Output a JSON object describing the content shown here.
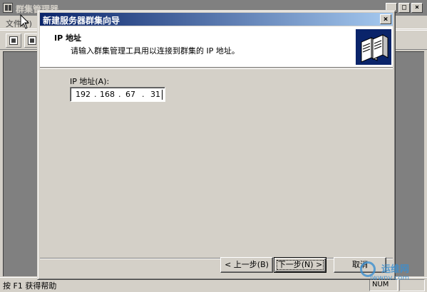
{
  "parent": {
    "title": "群集管理器",
    "menu_file": "文件(F)",
    "status_text": "按 F1 获得帮助",
    "status_panel": "NUM",
    "controls": {
      "minimize": "_",
      "maximize": "□",
      "close": "×"
    }
  },
  "wizard": {
    "title": "新建服务器群集向导",
    "close_glyph": "×",
    "header_title": "IP 地址",
    "header_subtitle": "请输入群集管理工具用以连接到群集的 IP 地址。",
    "ip_label": "IP 地址(A):",
    "ip_segments": [
      "192",
      "168",
      "67",
      "31"
    ],
    "ip_separator": ".",
    "buttons": {
      "back": "< 上一步(B)",
      "next": "下一步(N) >",
      "cancel": "取消"
    }
  },
  "watermark": {
    "cn": "运维网",
    "url": "iwwnv.com"
  },
  "colors": {
    "title_active_start": "#0a246a",
    "title_active_end": "#a6caf0",
    "title_inactive": "#808080",
    "face": "#d4d0c8",
    "watermark": "#3b8fd0"
  }
}
